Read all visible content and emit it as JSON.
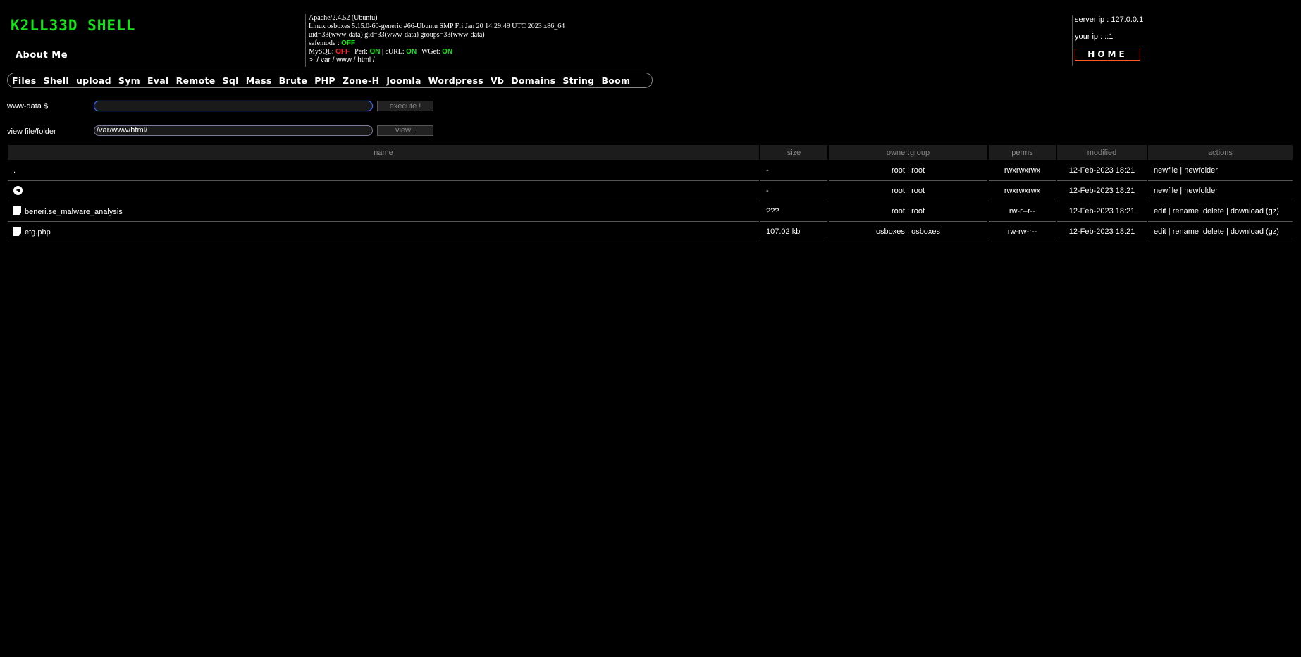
{
  "header": {
    "logo": "K2LL33D SHELL",
    "about": "About Me",
    "server_line": "Apache/2.4.52 (Ubuntu)",
    "kernel_line": "Linux osboxes 5.15.0-60-generic #66-Ubuntu SMP Fri Jan 20 14:29:49 UTC 2023 x86_64",
    "uid_line": "uid=33(www-data) gid=33(www-data) groups=33(www-data)",
    "safemode_label": "safemode : ",
    "safemode_value": "OFF",
    "mysql_label": "MySQL: ",
    "mysql_value": "OFF",
    "perl_label": " | Perl: ",
    "perl_value": "ON",
    "curl_label": " | cURL: ",
    "curl_value": "ON",
    "wget_label": " | WGet: ",
    "wget_value": "ON",
    "path_prefix": ">  ",
    "path_parts": [
      "/ var",
      " / www",
      " / html",
      " /"
    ],
    "server_ip": "server ip : 127.0.0.1",
    "your_ip": "your ip : ::1",
    "home": "HOME"
  },
  "menu": [
    "Files",
    "Shell",
    "upload",
    "Sym",
    "Eval",
    "Remote",
    "Sql",
    "Mass",
    "Brute",
    "PHP",
    "Zone-H",
    "Joomla",
    "Wordpress",
    "Vb",
    "Domains",
    "String",
    "Boom"
  ],
  "command": {
    "label": "www-data $",
    "value": "",
    "button": "execute !"
  },
  "view": {
    "label": "view file/folder",
    "value": "/var/www/html/",
    "button": "view !"
  },
  "table": {
    "headers": [
      "name",
      "size",
      "owner:group",
      "perms",
      "modified",
      "actions"
    ],
    "rows": [
      {
        "name": ".",
        "size": "-",
        "owner": "root : root",
        "perms": "rwxrwxrwx",
        "modified": "12-Feb-2023 18:21",
        "actions": "newfile | newfolder"
      },
      {
        "name": "",
        "size": "-",
        "owner": "root : root",
        "perms": "rwxrwxrwx",
        "modified": "12-Feb-2023 18:21",
        "actions": "newfile | newfolder"
      },
      {
        "name": "beneri.se_malware_analysis",
        "size": "???",
        "owner": "root : root",
        "perms": "rw-r--r--",
        "modified": "12-Feb-2023 18:21",
        "actions": "edit | rename| delete | download (gz)"
      },
      {
        "name": "etg.php",
        "size": "107.02 kb",
        "owner": "osboxes : osboxes",
        "perms": "rw-rw-r--",
        "modified": "12-Feb-2023 18:21",
        "actions": "edit | rename| delete | download (gz)"
      }
    ]
  },
  "colors": {
    "logo": "#16e11a",
    "on": "#16e11a",
    "off": "#ff2222",
    "home_border": "#ff5a1f"
  }
}
